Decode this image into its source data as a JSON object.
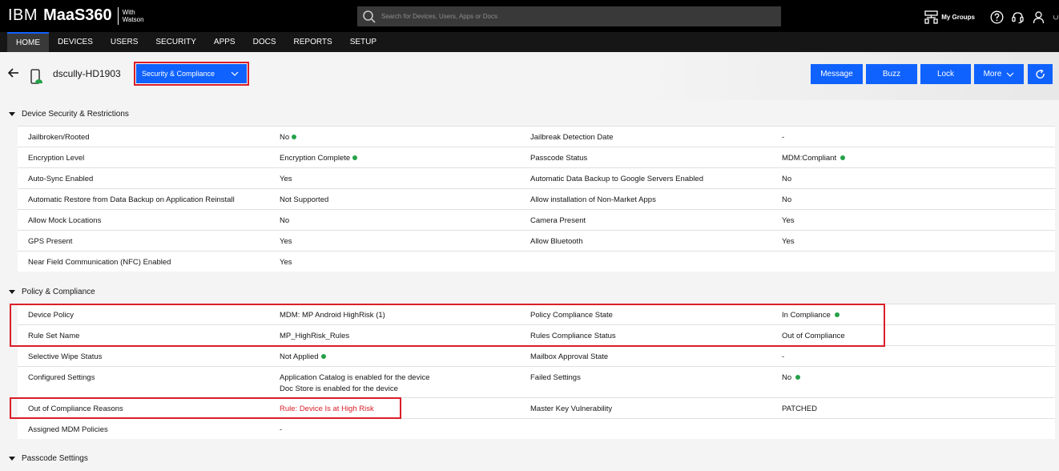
{
  "app": {
    "brand_ibm": "IBM",
    "brand_product": "MaaS360",
    "brand_with": "With",
    "brand_watson": "Watson",
    "search_placeholder": "Search for Devices, Users, Apps or Docs",
    "my_groups": "My Groups"
  },
  "nav": {
    "items": [
      "HOME",
      "DEVICES",
      "USERS",
      "SECURITY",
      "APPS",
      "DOCS",
      "REPORTS",
      "SETUP"
    ],
    "active": "HOME"
  },
  "header": {
    "device_name": "dscully-HD1903",
    "view_select": "Security & Compliance",
    "buttons": {
      "message": "Message",
      "buzz": "Buzz",
      "lock": "Lock",
      "more": "More"
    }
  },
  "sections": {
    "device_security": {
      "title": "Device Security & Restrictions",
      "rows": [
        {
          "l1": "Jailbroken/Rooted",
          "v1": "No",
          "v1_dot": true,
          "l2": "Jailbreak Detection Date",
          "v2": "-"
        },
        {
          "l1": "Encryption Level",
          "v1": "Encryption Complete",
          "v1_dot": true,
          "l2": "Passcode Status",
          "v2": "MDM:Compliant",
          "v2_dot": true
        },
        {
          "l1": "Auto-Sync Enabled",
          "v1": "Yes",
          "l2": "Automatic Data Backup to Google Servers Enabled",
          "v2": "No"
        },
        {
          "l1": "Automatic Restore from Data Backup on Application Reinstall",
          "v1": "Not Supported",
          "l2": "Allow installation of Non-Market Apps",
          "v2": "No"
        },
        {
          "l1": "Allow Mock Locations",
          "v1": "No",
          "l2": "Camera Present",
          "v2": "Yes"
        },
        {
          "l1": "GPS Present",
          "v1": "Yes",
          "l2": "Allow Bluetooth",
          "v2": "Yes"
        },
        {
          "l1": "Near Field Communication (NFC) Enabled",
          "v1": "Yes",
          "l2": "",
          "v2": ""
        }
      ]
    },
    "policy": {
      "title": "Policy & Compliance",
      "rows": [
        {
          "l1": "Device Policy",
          "v1": "MDM: MP Android HighRisk (1)",
          "l2": "Policy Compliance State",
          "v2": "In Compliance",
          "v2_dot": true
        },
        {
          "l1": "Rule Set Name",
          "v1": "MP_HighRisk_Rules",
          "l2": "Rules Compliance Status",
          "v2": "Out of Compliance"
        },
        {
          "l1": "Selective Wipe Status",
          "v1": "Not Applied",
          "v1_dot": true,
          "l2": "Mailbox Approval State",
          "v2": "-"
        },
        {
          "l1": "Configured Settings",
          "v1": "Application Catalog is enabled for the device",
          "v1b": "Doc Store is enabled for the device",
          "l2": "Failed Settings",
          "v2": "No",
          "v2_dot": true
        },
        {
          "l1": "Out of Compliance Reasons",
          "v1": "Rule: Device Is at High Risk",
          "l2": "Master Key Vulnerability",
          "v2": "PATCHED"
        },
        {
          "l1": "Assigned MDM Policies",
          "v1": "-",
          "l2": "",
          "v2": ""
        }
      ]
    },
    "passcode": {
      "title": "Passcode Settings"
    }
  },
  "colors": {
    "accent": "#0f62fe",
    "highlight": "#da1e28",
    "ok": "#24a148"
  }
}
